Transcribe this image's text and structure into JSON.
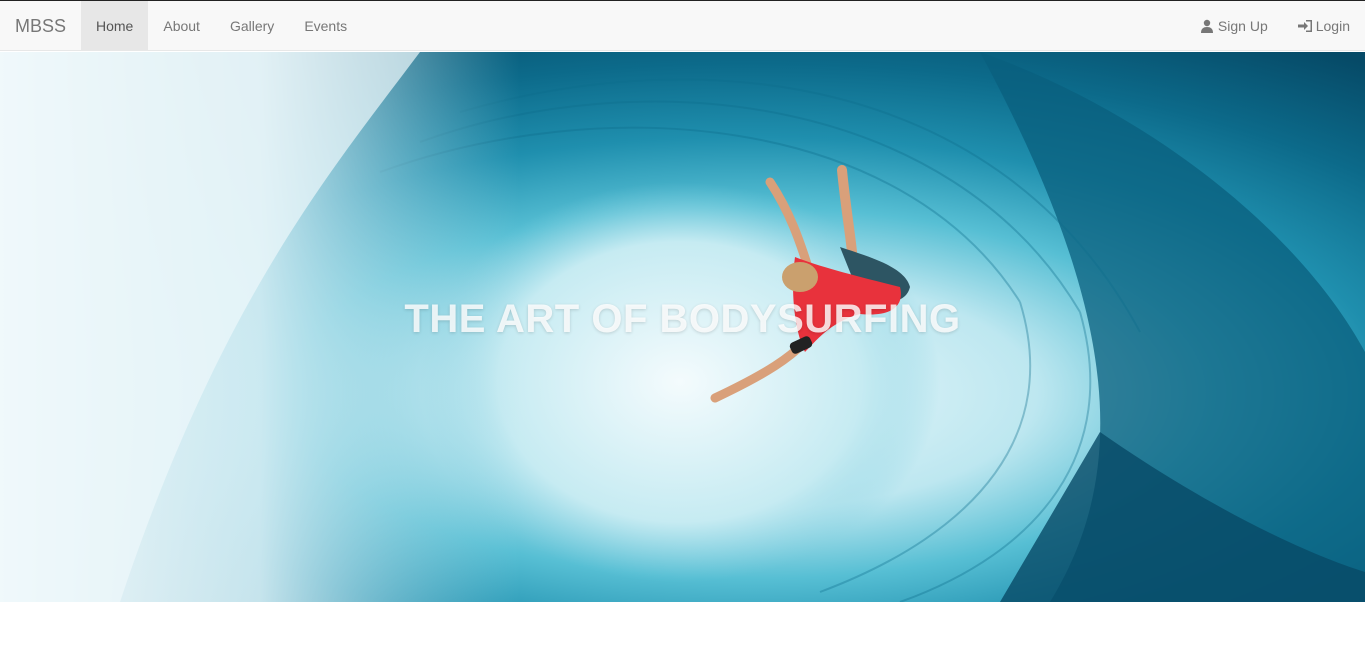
{
  "navbar": {
    "brand": "MBSS",
    "items": [
      {
        "label": "Home",
        "active": true
      },
      {
        "label": "About",
        "active": false
      },
      {
        "label": "Gallery",
        "active": false
      },
      {
        "label": "Events",
        "active": false
      }
    ],
    "right_items": [
      {
        "label": "Sign Up",
        "icon": "user-icon"
      },
      {
        "label": "Login",
        "icon": "login-icon"
      }
    ]
  },
  "hero": {
    "title": "THE ART OF BODYSURFING",
    "image_description_colors": {
      "wave_deep": "#0b6f8e",
      "wave_mid": "#2aa3bf",
      "foam": "#e6f4f8",
      "shirt": "#e8323c"
    }
  }
}
